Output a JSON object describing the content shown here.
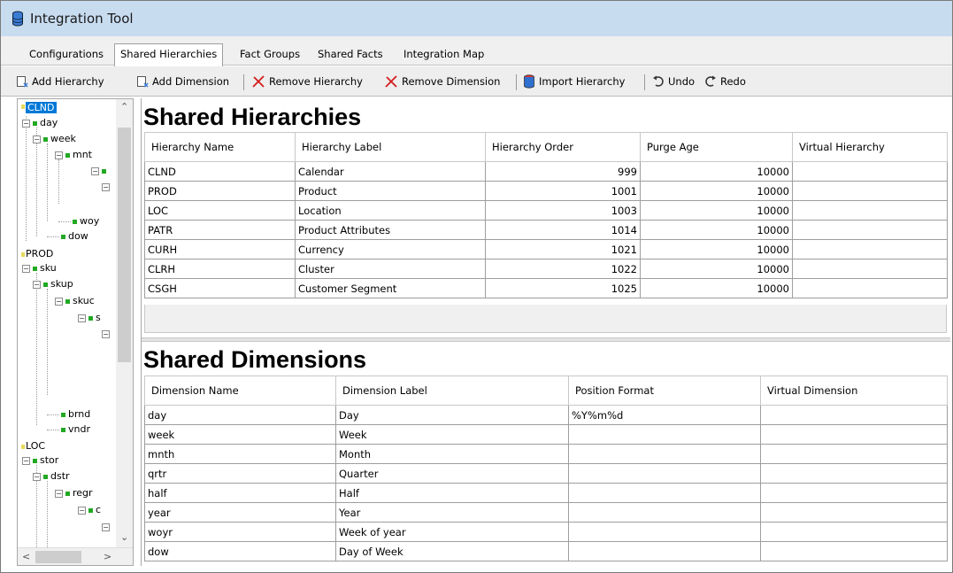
{
  "window": {
    "title": "Integration Tool",
    "accent": "#c8dcf0"
  },
  "tabs": [
    {
      "label": "Configurations",
      "active": false
    },
    {
      "label": "Shared Hierarchies",
      "active": true
    },
    {
      "label": "Fact Groups",
      "active": false
    },
    {
      "label": "Shared Facts",
      "active": false
    },
    {
      "label": "Integration Map",
      "active": false
    }
  ],
  "toolbar": {
    "add_hierarchy": "Add Hierarchy",
    "add_dimension": "Add Dimension",
    "remove_hierarchy": "Remove Hierarchy",
    "remove_dimension": "Remove Dimension",
    "import_hierarchy": "Import Hierarchy",
    "undo": "Undo",
    "redo": "Redo"
  },
  "tree": {
    "nodes": [
      {
        "label": "CLND",
        "selected": true
      },
      {
        "label": "day"
      },
      {
        "label": "week"
      },
      {
        "label": "mnt"
      },
      {
        "label": "woy"
      },
      {
        "label": "dow"
      },
      {
        "label": "PROD"
      },
      {
        "label": "sku"
      },
      {
        "label": "skup"
      },
      {
        "label": "skuc"
      },
      {
        "label": "s"
      },
      {
        "label": "brnd"
      },
      {
        "label": "vndr"
      },
      {
        "label": "LOC"
      },
      {
        "label": "stor"
      },
      {
        "label": "dstr"
      },
      {
        "label": "regr"
      },
      {
        "label": "c"
      }
    ]
  },
  "hierarchies": {
    "title": "Shared Hierarchies",
    "columns": [
      "Hierarchy Name",
      "Hierarchy Label",
      "Hierarchy Order",
      "Purge Age",
      "Virtual Hierarchy"
    ],
    "rows": [
      [
        "CLND",
        "Calendar",
        "999",
        "10000",
        ""
      ],
      [
        "PROD",
        "Product",
        "1001",
        "10000",
        ""
      ],
      [
        "LOC",
        "Location",
        "1003",
        "10000",
        ""
      ],
      [
        "PATR",
        "Product Attributes",
        "1014",
        "10000",
        ""
      ],
      [
        "CURH",
        "Currency",
        "1021",
        "10000",
        ""
      ],
      [
        "CLRH",
        "Cluster",
        "1022",
        "10000",
        ""
      ],
      [
        "CSGH",
        "Customer Segment",
        "1025",
        "10000",
        ""
      ]
    ]
  },
  "dimensions": {
    "title": "Shared Dimensions",
    "columns": [
      "Dimension Name",
      "Dimension Label",
      "Position Format",
      "Virtual Dimension"
    ],
    "rows": [
      [
        "day",
        "Day",
        "%Y%m%d",
        ""
      ],
      [
        "week",
        "Week",
        "",
        ""
      ],
      [
        "mnth",
        "Month",
        "",
        ""
      ],
      [
        "qrtr",
        "Quarter",
        "",
        ""
      ],
      [
        "half",
        "Half",
        "",
        ""
      ],
      [
        "year",
        "Year",
        "",
        ""
      ],
      [
        "woyr",
        "Week of year",
        "",
        ""
      ],
      [
        "dow",
        "Day of Week",
        "",
        ""
      ]
    ]
  }
}
